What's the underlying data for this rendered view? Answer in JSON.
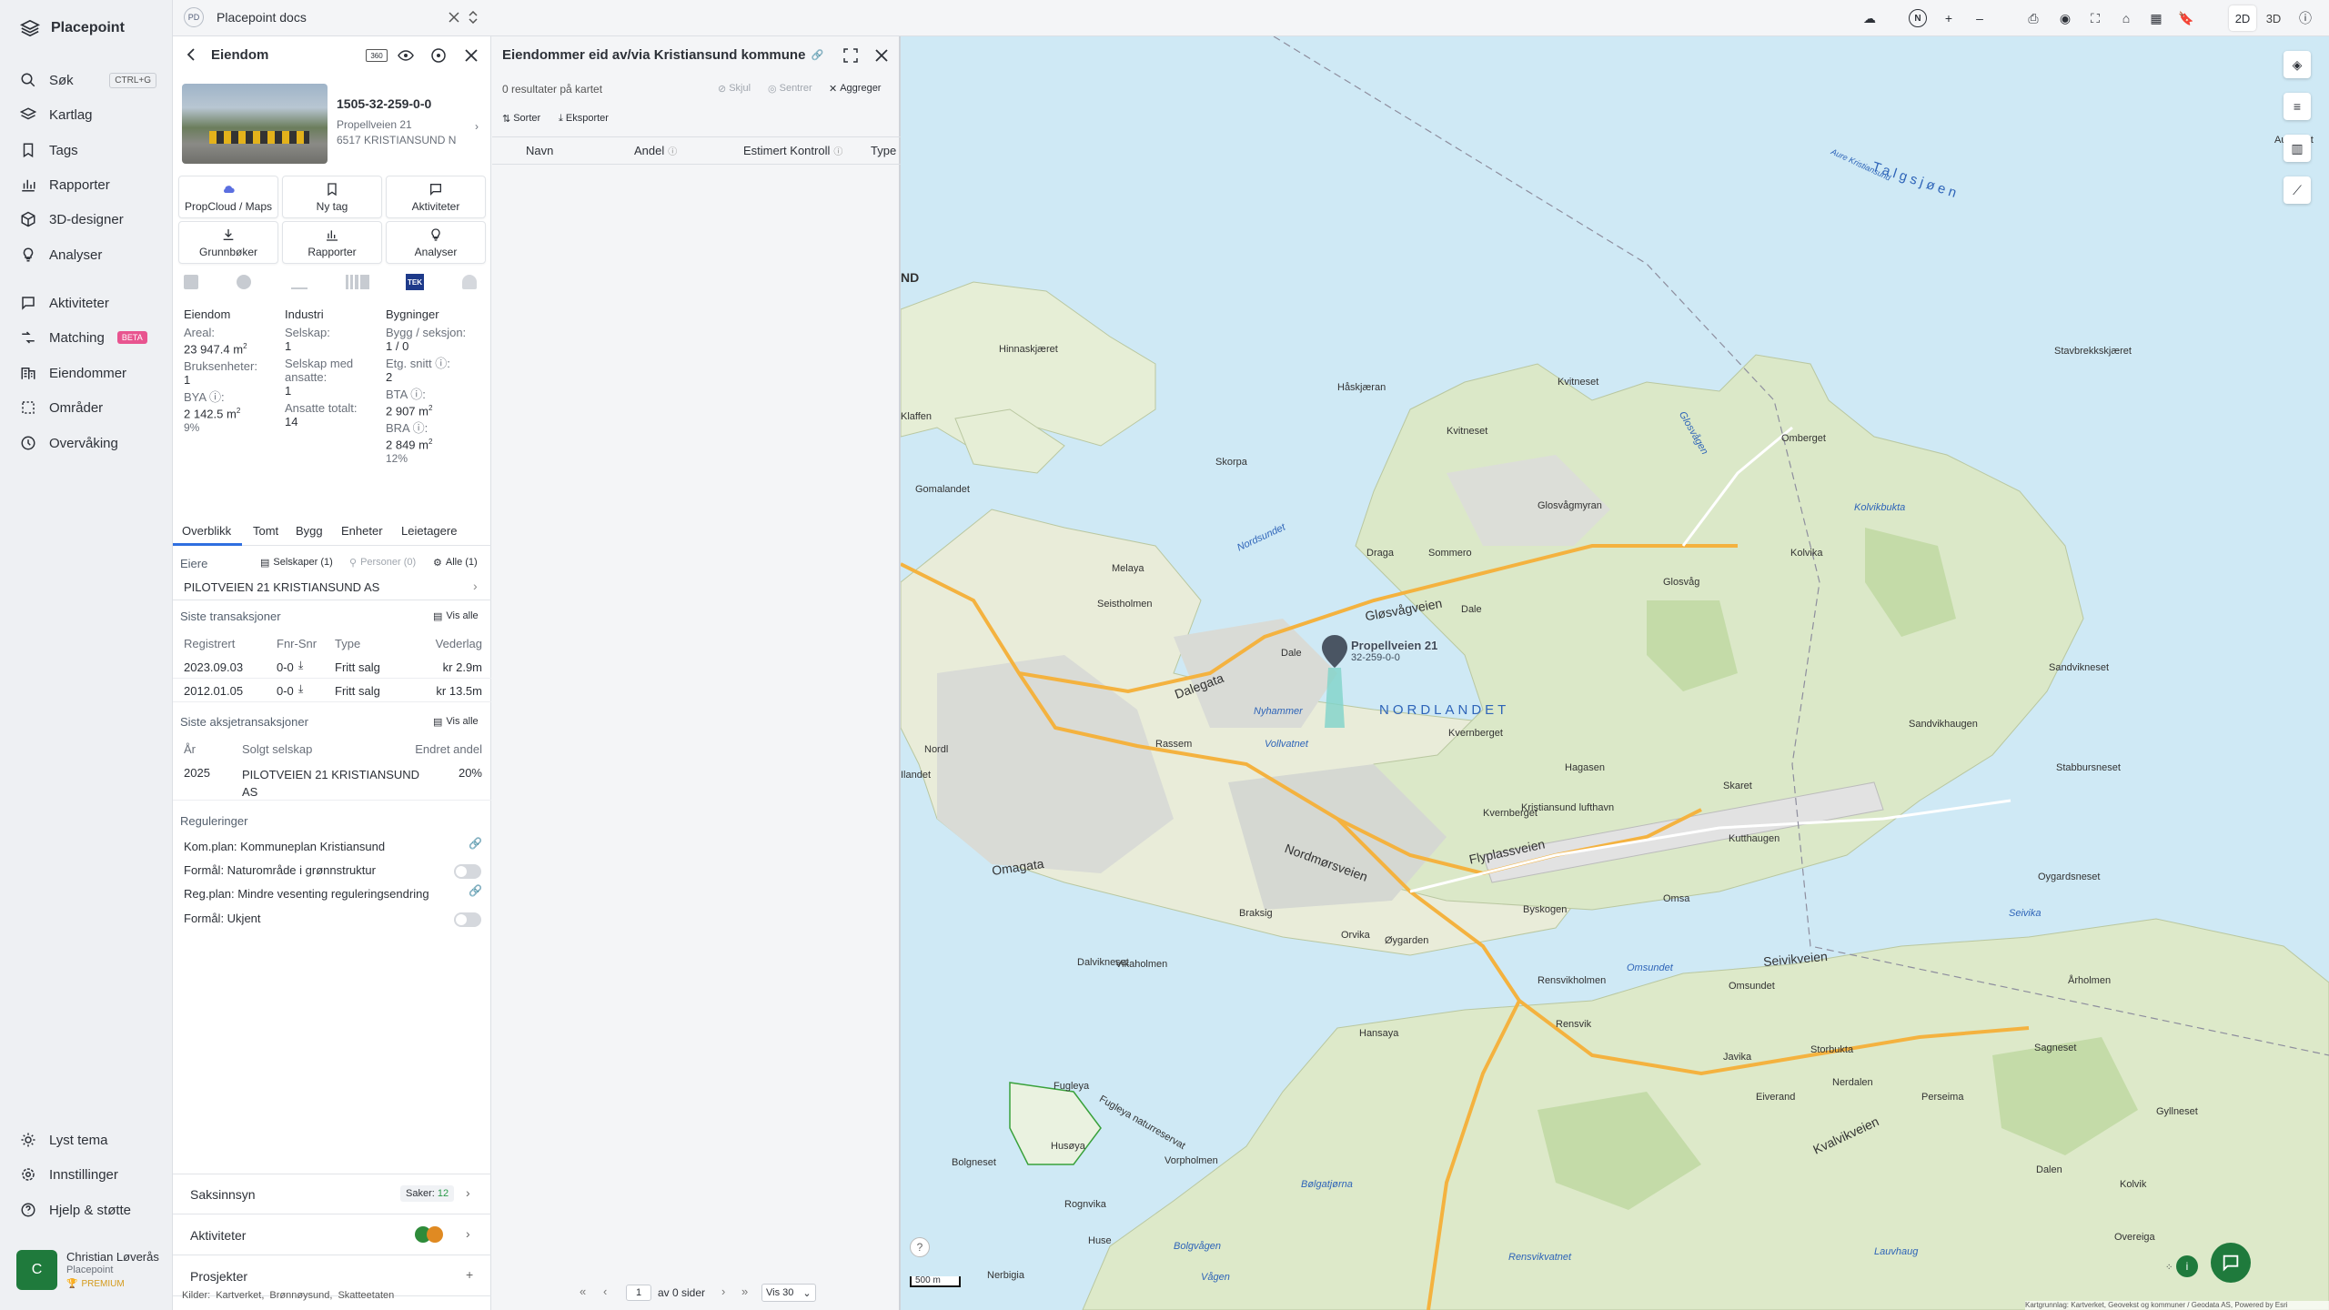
{
  "app": {
    "name": "Placepoint"
  },
  "nav": {
    "items": [
      {
        "label": "Søk",
        "shortcut": "CTRL+G"
      },
      {
        "label": "Kartlag"
      },
      {
        "label": "Tags"
      },
      {
        "label": "Rapporter"
      },
      {
        "label": "3D-designer"
      },
      {
        "label": "Analyser"
      },
      {
        "label": "Aktiviteter"
      },
      {
        "label": "Matching",
        "badge": "BETA"
      },
      {
        "label": "Eiendommer"
      },
      {
        "label": "Områder"
      },
      {
        "label": "Overvåking"
      }
    ],
    "bottom": [
      {
        "label": "Lyst tema"
      },
      {
        "label": "Innstillinger"
      },
      {
        "label": "Hjelp & støtte"
      }
    ],
    "user": {
      "initial": "C",
      "name": "Christian Løverås",
      "org": "Placepoint",
      "plan": "PREMIUM"
    }
  },
  "tab": {
    "badge": "PD",
    "title": "Placepoint docs"
  },
  "property": {
    "header": "Eiendom",
    "tek_badge": "TEK",
    "hdr_icon_text": "360",
    "id": "1505-32-259-0-0",
    "address1": "Propellveien 21",
    "address2": "6517 KRISTIANSUND N",
    "tiles": [
      {
        "label": "PropCloud / Maps",
        "icon": "cloud-icon"
      },
      {
        "label": "Ny tag",
        "icon": "bookmark-icon"
      },
      {
        "label": "Aktiviteter",
        "icon": "chat-icon"
      },
      {
        "label": "Grunnbøker",
        "icon": "download-icon"
      },
      {
        "label": "Rapporter",
        "icon": "bar-chart-icon"
      },
      {
        "label": "Analyser",
        "icon": "bulb-icon"
      }
    ],
    "facts": {
      "col1": {
        "title": "Eiendom",
        "areal_lbl": "Areal:",
        "areal": "23 947.4",
        "areal_unit": "m",
        "bruks_lbl": "Bruksenheter:",
        "bruks": "1",
        "bya_lbl": "BYA",
        "bya": "2 142.5",
        "bya_unit": "m",
        "bya_pct": "9%"
      },
      "col2": {
        "title": "Industri",
        "selskap_lbl": "Selskap:",
        "selskap": "1",
        "ans_lbl1": "Selskap med",
        "ans_lbl2": "ansatte:",
        "ans": "1",
        "tot_lbl": "Ansatte totalt:",
        "tot": "14"
      },
      "col3": {
        "title": "Bygninger",
        "bygg_lbl": "Bygg / seksjon:",
        "bygg": "1 / 0",
        "etg_lbl": "Etg. snitt",
        "etg": "2",
        "bta_lbl": "BTA",
        "bta": "2 907",
        "bta_unit": "m",
        "bra_lbl": "BRA",
        "bra": "2 849",
        "bra_unit": "m",
        "bra_pct": "12%"
      }
    },
    "tabs": [
      "Overblikk",
      "Tomt",
      "Bygg",
      "Enheter",
      "Leietagere"
    ],
    "owners": {
      "title": "Eiere",
      "f1": "Selskaper (1)",
      "f2": "Personer (0)",
      "f3": "Alle (1)",
      "name": "PILOTVEIEN 21 KRISTIANSUND AS"
    },
    "tx": {
      "title": "Siste transaksjoner",
      "see_all": "Vis alle",
      "cols": [
        "Registrert",
        "Fnr-Snr",
        "Type",
        "Vederlag"
      ],
      "rows": [
        {
          "date": "2023.09.03",
          "fnr": "0-0",
          "type": "Fritt salg",
          "amount": "kr 2.9m"
        },
        {
          "date": "2012.01.05",
          "fnr": "0-0",
          "type": "Fritt salg",
          "amount": "kr 13.5m"
        }
      ]
    },
    "stx": {
      "title": "Siste aksjetransaksjoner",
      "see_all": "Vis alle",
      "cols": [
        "År",
        "Solgt selskap",
        "Endret andel"
      ],
      "year": "2025",
      "company1": "PILOTVEIEN 21 KRISTIANSUND",
      "company2": "AS",
      "share": "20%"
    },
    "reg": {
      "title": "Reguleringer",
      "items": [
        "Kom.plan: Kommuneplan Kristiansund",
        "Formål: Naturområde i grønnstruktur",
        "Reg.plan: Mindre vesenting reguleringsendring",
        "Formål: Ukjent"
      ]
    },
    "sections": {
      "saks": "Saksinnsyn",
      "saker_lbl": "Saker:",
      "saker": "12",
      "akt": "Aktiviteter",
      "prosj": "Prosjekter",
      "plus": "+"
    },
    "sources": {
      "lbl": "Kilder:",
      "items": [
        "Kartverket,",
        "Brønnøysund,",
        "Skatteetaten"
      ]
    }
  },
  "results": {
    "title": "Eiendommer eid av/via Kristiansund kommune",
    "count": "0 resultater på kartet",
    "actions": [
      "Skjul",
      "Sentrer",
      "Aggreger"
    ],
    "sort": "Sorter",
    "export": "Eksporter",
    "cols": [
      "Navn",
      "Andel",
      "Estimert Kontroll",
      "Type"
    ],
    "pager": {
      "page": "1",
      "of": "av 0 sider",
      "per": "Vis 30"
    }
  },
  "map": {
    "mode2d": "2D",
    "mode3d": "3D",
    "north": "N",
    "scale": "500 m",
    "attribution": "Kartgrunnlag: Kartverket, Geovekst og kommuner / Geodata AS, Powered by Esri",
    "marker_label": "Propellveien 21",
    "marker_sub": "32-259-0-0",
    "edge_label": "ND",
    "labels": [
      "Hinnaskjæret",
      "Håskjæran",
      "Kvitneset",
      "Kvitneset",
      "Skorpa",
      "Nordsundet",
      "Glosvågmyran",
      "Glosvågen",
      "Omberget",
      "Kolvikbukta",
      "Kolvika",
      "Draga",
      "Sommero",
      "Glosvåg",
      "Gløsvågveien",
      "Dale",
      "Melaya",
      "Seistholmen",
      "Dalegata",
      "Dale",
      "Nyhammer",
      "Vollvatnet",
      "Rassem",
      "Kvernberget",
      "NORDLANDET",
      "Sandvikhaugen",
      "Sandvikneset",
      "Stabbursneset",
      "Hagasen",
      "Skaret",
      "Kristiansund lufthavn",
      "Kvernberget",
      "Flyplassveien",
      "Kutthaugen",
      "Nordmørsveien",
      "Omagata",
      "Braksig",
      "Orvika",
      "Øygarden",
      "Byskogen",
      "Omsa",
      "Seivikveien",
      "Seivika",
      "Oygardsneset",
      "Dalvikneset",
      "Vikaholmen",
      "Omsundet",
      "Omsundet",
      "Rensvikholmen",
      "Årholmen",
      "Hansaya",
      "Rensvik",
      "Javika",
      "Storbukta",
      "Sagneset",
      "Nerdalen",
      "Perseima",
      "Gyllneset",
      "Fugleya",
      "Fugleya naturreservat",
      "Husøya",
      "Kvalvikveien",
      "Eiverand",
      "Bolgneset",
      "Vorpholmen",
      "Bølgatjørna",
      "Rognvika",
      "Huse",
      "Bolgvågen",
      "Nerbigia",
      "Vågen",
      "Lauvhaug",
      "Rensvikvatnet",
      "Overeiga",
      "Dalen",
      "Kolvik",
      "Aureisiet",
      "Talgsjøen",
      "Aure Kristiansund",
      "Stavbrekkskjæret",
      "Klaffen",
      "Gomalandet",
      "Nordl",
      "Ilandet"
    ]
  }
}
